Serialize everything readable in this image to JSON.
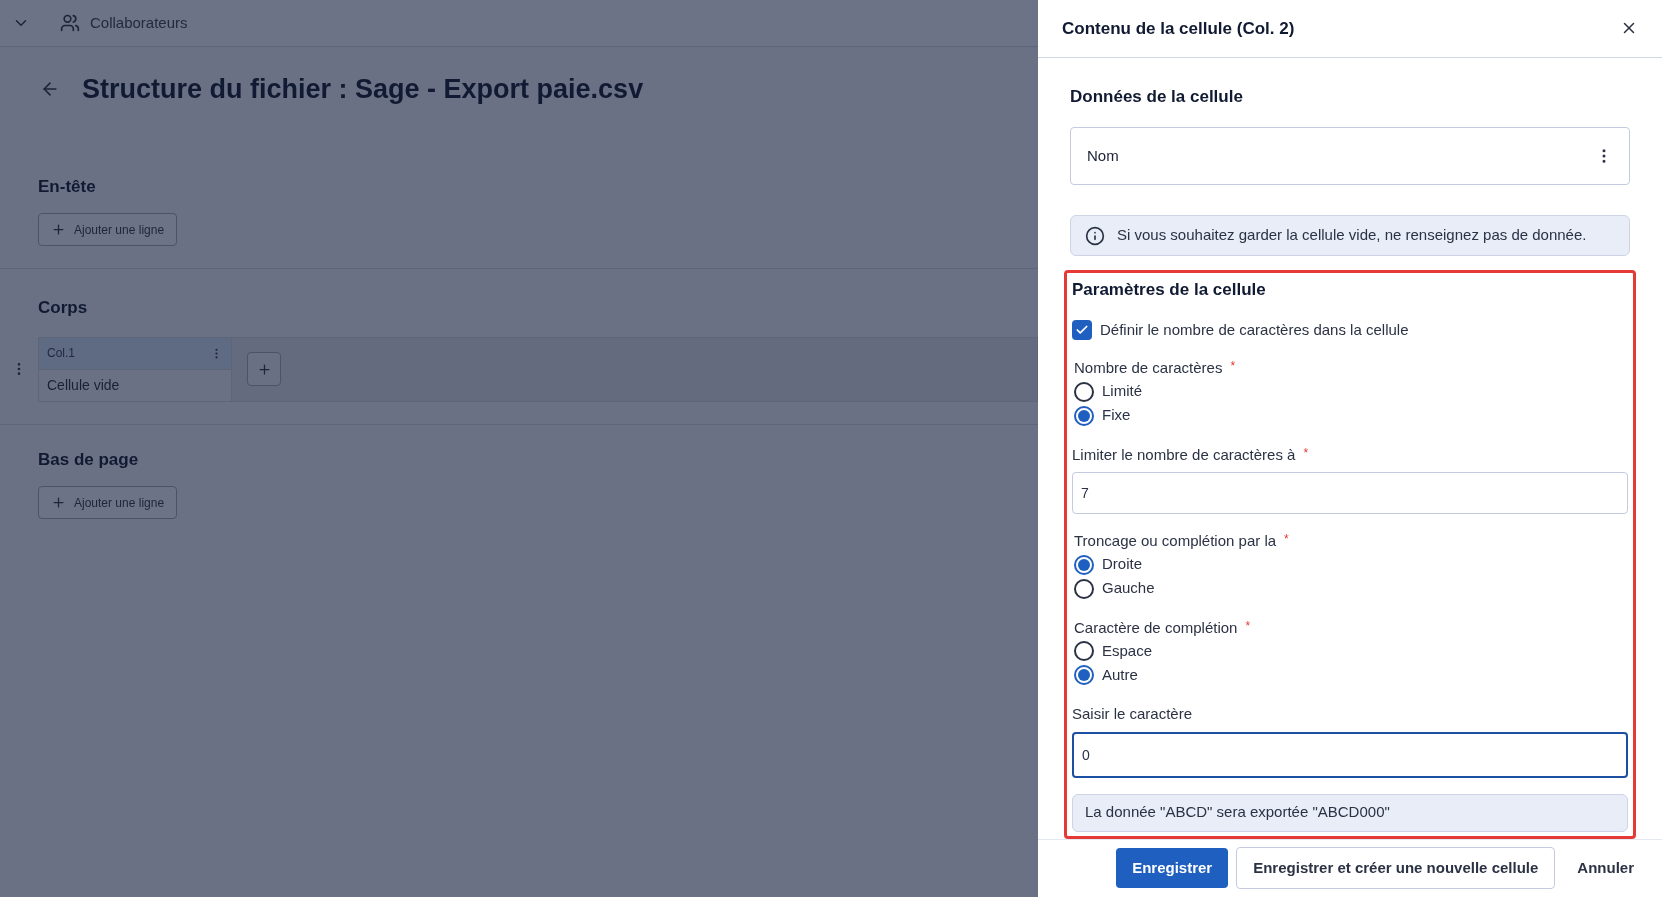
{
  "topbar": {
    "menu_label": "Collaborateurs"
  },
  "page": {
    "title": "Structure du fichier : Sage - Export paie.csv",
    "sections": [
      {
        "title": "En-tête",
        "kind": "add",
        "button": "Ajouter une ligne"
      },
      {
        "title": "Corps",
        "kind": "table",
        "columns": [
          {
            "header": "Col.1",
            "cell": "Cellule vide"
          }
        ]
      },
      {
        "title": "Bas de page",
        "kind": "add",
        "button": "Ajouter une ligne"
      }
    ]
  },
  "panel": {
    "title": "Contenu de la cellule (Col. 2)",
    "data_title": "Données de la cellule",
    "data_value": "Nom",
    "info": "Si vous souhaitez garder la cellule vide, ne renseignez pas de donnée.",
    "params_title": "Paramètres de la cellule",
    "checkbox": {
      "label": "Définir le nombre de caractères dans la cellule",
      "checked": true
    },
    "fields": [
      {
        "kind": "radio",
        "label": "Nombre de caractères",
        "required_mark": "*",
        "options": [
          {
            "label": "Limité",
            "selected": false
          },
          {
            "label": "Fixe",
            "selected": true
          }
        ]
      },
      {
        "kind": "input",
        "label": "Limiter le nombre de caractères à",
        "required_mark": "*",
        "value": "7",
        "focused": false
      },
      {
        "kind": "radio",
        "label": "Troncage ou complétion par la",
        "required_mark": "*",
        "options": [
          {
            "label": "Droite",
            "selected": true
          },
          {
            "label": "Gauche",
            "selected": false
          }
        ]
      },
      {
        "kind": "radio",
        "label": "Caractère de complétion",
        "required_mark": "*",
        "options": [
          {
            "label": "Espace",
            "selected": false
          },
          {
            "label": "Autre",
            "selected": true
          }
        ]
      },
      {
        "kind": "input",
        "label": "Saisir le caractère",
        "value": "0",
        "focused": true
      }
    ],
    "preview": "La donnée \"ABCD\" sera exportée \"ABCD000\"",
    "buttons": [
      {
        "label": "Enregistrer",
        "kind": "primary"
      },
      {
        "label": "Enregistrer et créer une nouvelle cellule",
        "kind": "outline"
      },
      {
        "label": "Annuler",
        "kind": "text"
      }
    ]
  }
}
